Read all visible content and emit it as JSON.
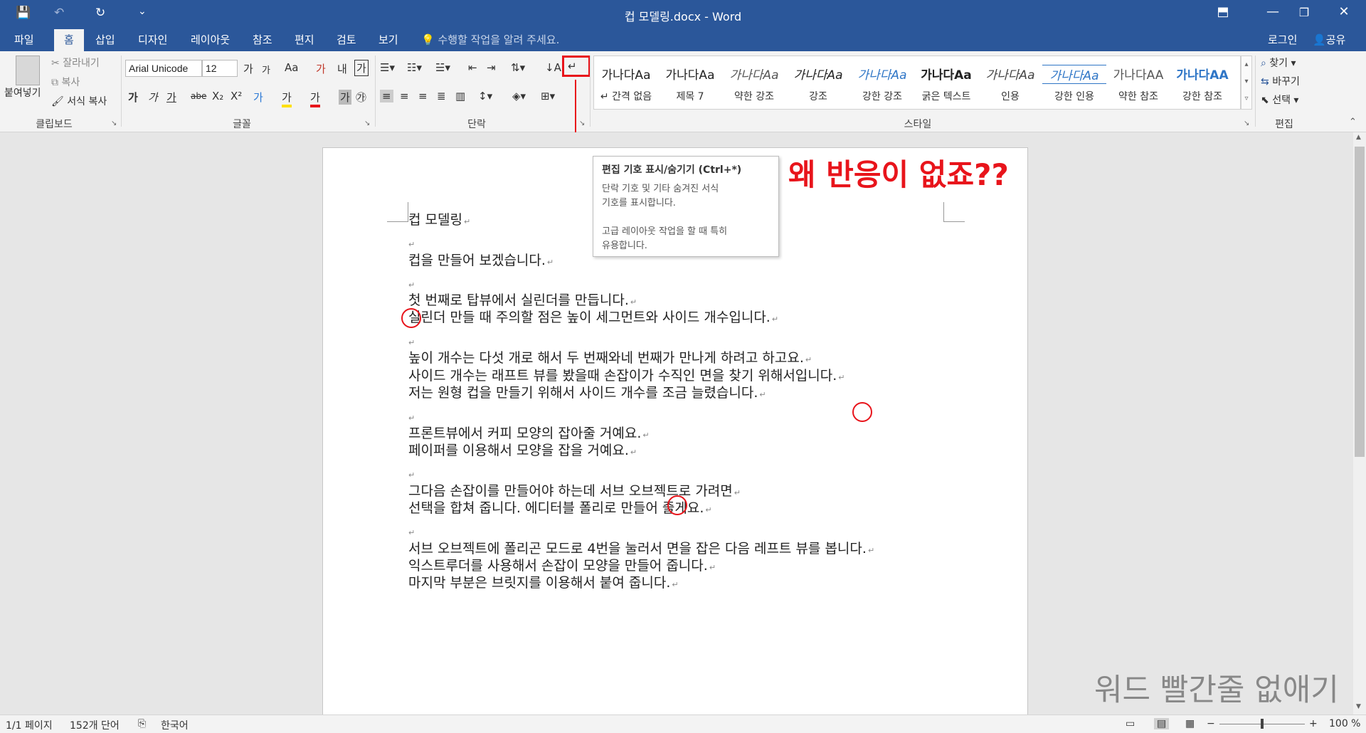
{
  "titlebar": {
    "title": "컵 모델링.docx - Word",
    "qa_save": "💾",
    "qa_undo": "↶",
    "qa_redo": "↻",
    "qa_customize": "⌄",
    "btn_ribbon_display": "⬒",
    "btn_minimize": "—",
    "btn_restore": "❐",
    "btn_close": "✕"
  },
  "tabs": {
    "file": "파일",
    "home": "홈",
    "insert": "삽입",
    "design": "디자인",
    "layout": "레이아웃",
    "references": "참조",
    "mailings": "편지",
    "review": "검토",
    "view": "보기",
    "tell_me": "수행할 작업을 알려 주세요.",
    "login": "로그인",
    "share": "공유"
  },
  "ribbon": {
    "clipboard": {
      "paste": "붙여넣기",
      "cut": "잘라내기",
      "copy": "복사",
      "format_painter": "서식 복사",
      "label": "클립보드"
    },
    "font": {
      "font_name": "Arial Unicode",
      "font_size": "12",
      "grow": "가",
      "shrink": "가",
      "case": "Aa",
      "clear": "가",
      "phonetic": "내",
      "border": "가",
      "bold": "가",
      "italic": "가",
      "underline": "가",
      "strike": "abe",
      "subscript": "X₂",
      "superscript": "X²",
      "effects": "가",
      "highlight": "가",
      "color": "가",
      "shade": "가",
      "circle": "㉮",
      "label": "글꼴"
    },
    "paragraph": {
      "label": "단락",
      "show_marks": "↵"
    },
    "styles": {
      "label": "스타일",
      "items": [
        {
          "preview": "가나다Aa",
          "name": "↵ 간격 없음"
        },
        {
          "preview": "가나다Aa",
          "name": "제목 7"
        },
        {
          "preview": "가나다Aa",
          "name": "약한 강조"
        },
        {
          "preview": "가나다Aa",
          "name": "강조"
        },
        {
          "preview": "가나다Aa",
          "name": "강한 강조"
        },
        {
          "preview": "가나다Aa",
          "name": "굵은 텍스트"
        },
        {
          "preview": "가나다Aa",
          "name": "인용"
        },
        {
          "preview": "가나다Aa",
          "name": "강한 인용"
        },
        {
          "preview": "가나다AA",
          "name": "약한 참조"
        },
        {
          "preview": "가나다AA",
          "name": "강한 참조"
        }
      ]
    },
    "editing": {
      "label": "편집",
      "find": "찾기",
      "replace": "바꾸기",
      "select": "선택"
    }
  },
  "tooltip": {
    "title": "편집 기호 표시/숨기기 (Ctrl+*)",
    "body": "단락 기호 및 기타 숨겨진 서식\n기호를 표시합니다.\n\n고급 레이아웃 작업을 할 때 특히\n유용합니다."
  },
  "callout": "왜 반응이 없죠??",
  "watermark": "워드 빨간줄 없애기",
  "document": {
    "pilcrow": "↵",
    "lines": [
      "컵 모델링",
      "",
      "컵을 만들어 보겠습니다.",
      "",
      "첫 번째로 탑뷰에서 실린더를  만듭니다.",
      "실린더 만들 때 주의할 점은 높이  세그먼트와 사이드 개수입니다.",
      "",
      "높이 개수는 다섯 개로 해서 두 번째와네 번째가 만나게 하려고 하고요.",
      "사이드 개수는 래프트 뷰를 봤을때  손잡이가 수직인 면을 찾기 위해서입니다.",
      "저는 원형 컵을 만들기 위해서 사이드 개수를  조금 늘렸습니다.",
      "",
      "프론트뷰에서 커피 모양의 잡아줄 거예요.",
      "페이퍼를 이용해서 모양을 잡을 거예요.",
      "",
      "그다음 손잡이를  만들어야 하는데 서브 오브젝트로  가려면",
      " 선택을 합쳐 줍니다.  에디터블 폴리로 만들어 줄게요.",
      "",
      " 서브 오브젝트에 폴리곤 모드로 4번을 눌러서 면을 잡은 다음 레프트 뷰를 봅니다.",
      "익스트루더를 사용해서 손잡이 모양을 만들어 줍니다.",
      " 마지막 부분은 브릿지를 이용해서 붙여 줍니다."
    ]
  },
  "statusbar": {
    "page": "1/1 페이지",
    "words": "152개 단어",
    "language": "한국어",
    "zoom": "100 %"
  }
}
